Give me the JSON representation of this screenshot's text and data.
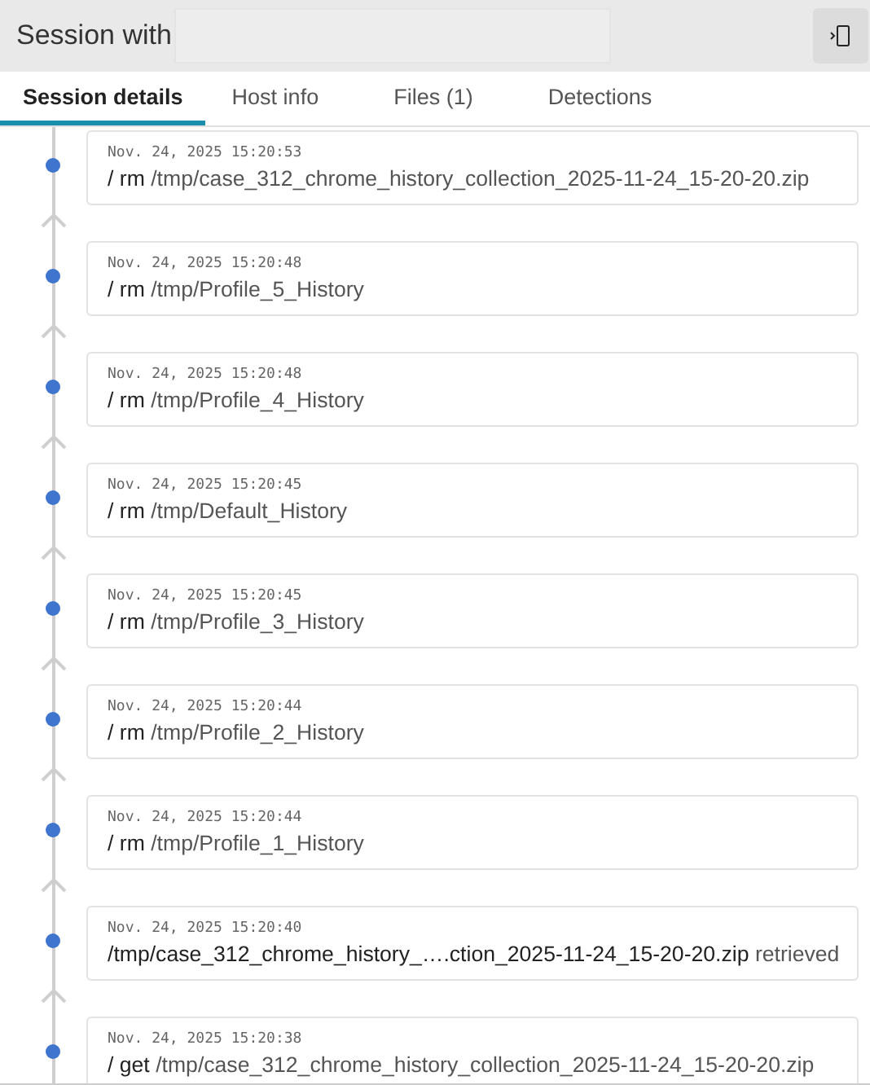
{
  "header": {
    "title": "Session with",
    "redacted": true
  },
  "tabs": [
    {
      "label": "Session details",
      "selected": true
    },
    {
      "label": "Host info",
      "selected": false
    },
    {
      "label": "Files (1)",
      "selected": false
    },
    {
      "label": "Detections",
      "selected": false
    }
  ],
  "events": [
    {
      "kind": "command",
      "time": "Nov. 24, 2025 15:20:53",
      "command": "/ rm",
      "path": "/tmp/case_312_chrome_history_collection_2025-11-24_15-20-20.zip"
    },
    {
      "kind": "command",
      "time": "Nov. 24, 2025 15:20:48",
      "command": "/ rm",
      "path": "/tmp/Profile_5_History"
    },
    {
      "kind": "command",
      "time": "Nov. 24, 2025 15:20:48",
      "command": "/ rm",
      "path": "/tmp/Profile_4_History"
    },
    {
      "kind": "command",
      "time": "Nov. 24, 2025 15:20:45",
      "command": "/ rm",
      "path": "/tmp/Default_History"
    },
    {
      "kind": "command",
      "time": "Nov. 24, 2025 15:20:45",
      "command": "/ rm",
      "path": "/tmp/Profile_3_History"
    },
    {
      "kind": "command",
      "time": "Nov. 24, 2025 15:20:44",
      "command": "/ rm",
      "path": "/tmp/Profile_2_History"
    },
    {
      "kind": "command",
      "time": "Nov. 24, 2025 15:20:44",
      "command": "/ rm",
      "path": "/tmp/Profile_1_History"
    },
    {
      "kind": "file",
      "time": "Nov. 24, 2025 15:20:40",
      "path": "/tmp/case_312_chrome_history_….ction_2025-11-24_15-20-20.zip",
      "status": "retrieved"
    },
    {
      "kind": "command",
      "time": "Nov. 24, 2025 15:20:38",
      "command": "/ get",
      "path": "/tmp/case_312_chrome_history_collection_2025-11-24_15-20-20.zip"
    }
  ]
}
